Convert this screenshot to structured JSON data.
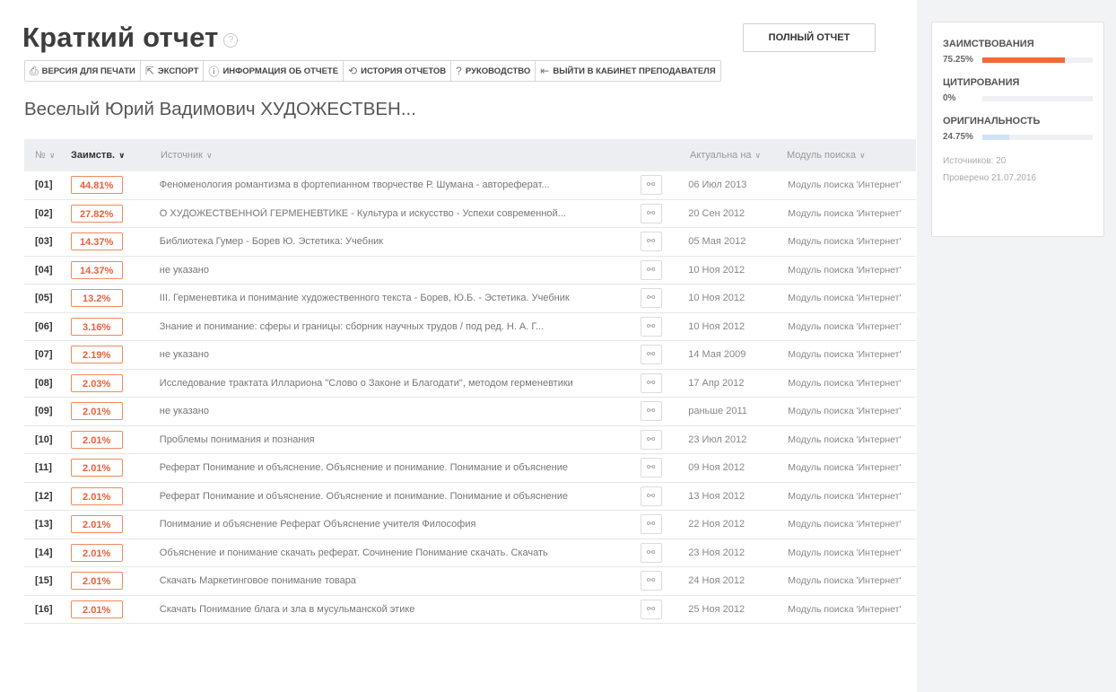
{
  "header": {
    "title": "Краткий отчет",
    "help_symbol": "?",
    "full_report_label": "ПОЛНЫЙ ОТЧЕТ"
  },
  "toolbar": {
    "print": "ВЕРСИЯ ДЛЯ ПЕЧАТИ",
    "export": "ЭКСПОРТ",
    "info": "ИНФОРМАЦИЯ ОБ ОТЧЕТЕ",
    "history": "ИСТОРИЯ ОТЧЕТОВ",
    "guide": "РУКОВОДСТВО",
    "exit": "ВЫЙТИ В КАБИНЕТ ПРЕПОДАВАТЕЛЯ"
  },
  "document_title": "Веселый Юрий Вадимович ХУДОЖЕСТВЕН...",
  "table": {
    "headers": {
      "num": "№",
      "borrow": "Заимств.",
      "source": "Источник",
      "date": "Актуальна на",
      "module": "Модуль поиска"
    },
    "rows": [
      {
        "num": "[01]",
        "pct": "44.81%",
        "source": "Феноменология романтизма в фортепианном творчестве Р. Шумана - автореферат...",
        "date": "06 Июл 2013",
        "module": "Модуль поиска 'Интернет'"
      },
      {
        "num": "[02]",
        "pct": "27.82%",
        "source": "О ХУДОЖЕСТВЕННОЙ ГЕРМЕНЕВТИКЕ - Культура и искусство - Успехи современной...",
        "date": "20 Сен 2012",
        "module": "Модуль поиска 'Интернет'"
      },
      {
        "num": "[03]",
        "pct": "14.37%",
        "source": "Библиотека Гумер - Борев Ю. Эстетика: Учебник",
        "date": "05 Мая 2012",
        "module": "Модуль поиска 'Интернет'"
      },
      {
        "num": "[04]",
        "pct": "14.37%",
        "source": "не указано",
        "date": "10 Ноя 2012",
        "module": "Модуль поиска 'Интернет'"
      },
      {
        "num": "[05]",
        "pct": "13.2%",
        "source": "III. Герменевтика и понимание художественного текста - Борев, Ю.Б. - Эстетика. Учебник",
        "date": "10 Ноя 2012",
        "module": "Модуль поиска 'Интернет'"
      },
      {
        "num": "[06]",
        "pct": "3.16%",
        "source": "Знание и понимание: сферы и границы: сборник научных трудов / под ред. Н. А. Г...",
        "date": "10 Ноя 2012",
        "module": "Модуль поиска 'Интернет'"
      },
      {
        "num": "[07]",
        "pct": "2.19%",
        "source": "не указано",
        "date": "14 Мая 2009",
        "module": "Модуль поиска 'Интернет'"
      },
      {
        "num": "[08]",
        "pct": "2.03%",
        "source": "Исследование трактата Иллариона \"Слово о Законе и Благодати\", методом герменевтики",
        "date": "17 Апр 2012",
        "module": "Модуль поиска 'Интернет'"
      },
      {
        "num": "[09]",
        "pct": "2.01%",
        "source": "не указано",
        "date": "раньше 2011",
        "module": "Модуль поиска 'Интернет'"
      },
      {
        "num": "[10]",
        "pct": "2.01%",
        "source": "Проблемы понимания и познания",
        "date": "23 Июл 2012",
        "module": "Модуль поиска 'Интернет'"
      },
      {
        "num": "[11]",
        "pct": "2.01%",
        "source": "Реферат Понимание и объяснение. Объяснение и понимание. Понимание и объяснение",
        "date": "09 Ноя 2012",
        "module": "Модуль поиска 'Интернет'"
      },
      {
        "num": "[12]",
        "pct": "2.01%",
        "source": "Реферат Понимание и объяснение. Объяснение и понимание. Понимание и объяснение",
        "date": "13 Ноя 2012",
        "module": "Модуль поиска 'Интернет'"
      },
      {
        "num": "[13]",
        "pct": "2.01%",
        "source": "Понимание и объяснение Реферат Объяснение учителя Философия",
        "date": "22 Ноя 2012",
        "module": "Модуль поиска 'Интернет'"
      },
      {
        "num": "[14]",
        "pct": "2.01%",
        "source": "Объяснение и понимание скачать реферат. Сочинение Понимание скачать. Скачать",
        "date": "23 Ноя 2012",
        "module": "Модуль поиска 'Интернет'"
      },
      {
        "num": "[15]",
        "pct": "2.01%",
        "source": "Скачать Маркетинговое понимание товара",
        "date": "24 Ноя 2012",
        "module": "Модуль поиска 'Интернет'"
      },
      {
        "num": "[16]",
        "pct": "2.01%",
        "source": "Скачать Понимание блага и зла в мусульманской этике",
        "date": "25 Ноя 2012",
        "module": "Модуль поиска 'Интернет'"
      }
    ]
  },
  "summary": {
    "borrow_label": "ЗАИМСТВОВАНИЯ",
    "borrow_value": "75.25%",
    "borrow_fraction": 0.7525,
    "borrow_color": "#f06a35",
    "cite_label": "ЦИТИРОВАНИЯ",
    "cite_value": "0%",
    "cite_fraction": 0,
    "cite_color": "#7fb2e6",
    "orig_label": "ОРИГИНАЛЬНОСТЬ",
    "orig_value": "24.75%",
    "orig_fraction": 0.2475,
    "orig_color": "#cfe3f6",
    "sources_text": "Источников: 20",
    "checked_text": "Проверено 21.07.2016"
  }
}
